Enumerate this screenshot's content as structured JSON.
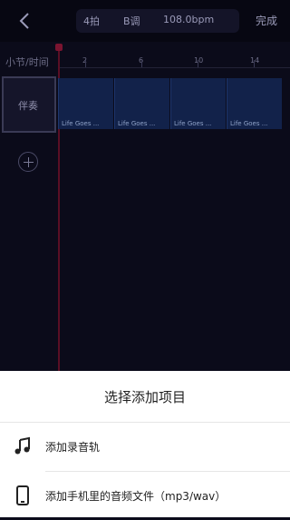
{
  "header": {
    "time_signature": "4拍",
    "key": "B调",
    "tempo": "108.0bpm",
    "done_label": "完成"
  },
  "timeline": {
    "ruler_label": "小节/时间",
    "ticks": [
      "2",
      "6",
      "10",
      "14"
    ],
    "track_label": "伴奏",
    "clips": [
      "Life Goes ...",
      "Life Goes ...",
      "Life Goes ...",
      "Life Goes ..."
    ]
  },
  "sheet": {
    "title": "选择添加项目",
    "items": [
      {
        "label": "添加录音轨",
        "icon": "music-note-icon"
      },
      {
        "label": "添加手机里的音频文件（mp3/wav）",
        "icon": "phone-icon"
      }
    ]
  },
  "colors": {
    "background": "#0b0b1a",
    "clip": "#12224a",
    "playhead": "#5a0f25",
    "sheet": "#ffffff"
  }
}
